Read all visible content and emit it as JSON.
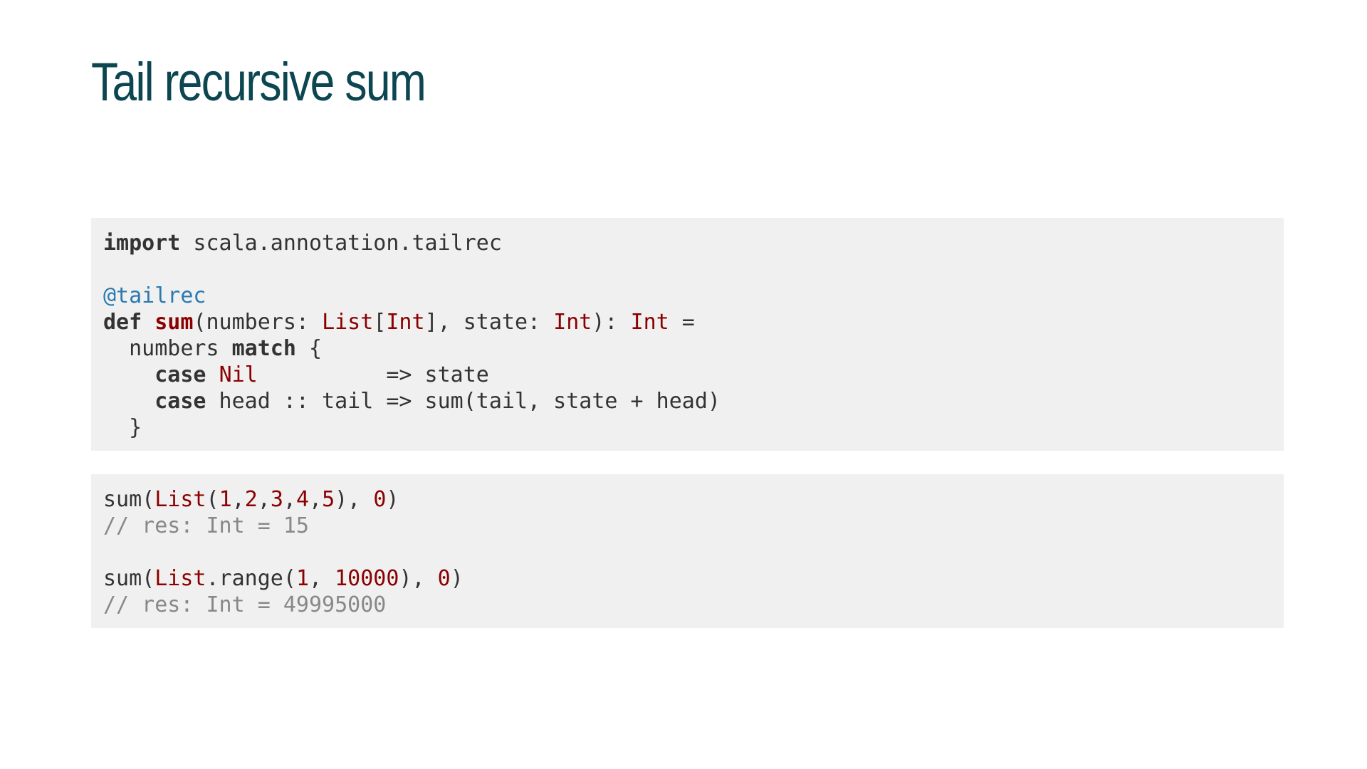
{
  "title": "Tail recursive sum",
  "colors": {
    "title": "#0c4650",
    "code_background": "#f0f0f0",
    "code_text": "#333333",
    "type_red": "#8b0000",
    "annotation_blue": "#2a7ab0",
    "comment_gray": "#888888"
  },
  "code_blocks": [
    {
      "lines": [
        [
          {
            "t": "import",
            "k": "kw"
          },
          {
            "t": " scala.annotation.tailrec",
            "k": "plain"
          }
        ],
        [],
        [
          {
            "t": "@tailrec",
            "k": "anno"
          }
        ],
        [
          {
            "t": "def",
            "k": "kw"
          },
          {
            "t": " ",
            "k": "plain"
          },
          {
            "t": "sum",
            "k": "fn"
          },
          {
            "t": "(numbers: ",
            "k": "plain"
          },
          {
            "t": "List",
            "k": "type"
          },
          {
            "t": "[",
            "k": "plain"
          },
          {
            "t": "Int",
            "k": "type"
          },
          {
            "t": "], state: ",
            "k": "plain"
          },
          {
            "t": "Int",
            "k": "type"
          },
          {
            "t": "): ",
            "k": "plain"
          },
          {
            "t": "Int",
            "k": "type"
          },
          {
            "t": " =",
            "k": "plain"
          }
        ],
        [
          {
            "t": "  numbers ",
            "k": "plain"
          },
          {
            "t": "match",
            "k": "kw"
          },
          {
            "t": " {",
            "k": "plain"
          }
        ],
        [
          {
            "t": "    ",
            "k": "plain"
          },
          {
            "t": "case",
            "k": "kw"
          },
          {
            "t": " ",
            "k": "plain"
          },
          {
            "t": "Nil",
            "k": "type"
          },
          {
            "t": "          => state",
            "k": "plain"
          }
        ],
        [
          {
            "t": "    ",
            "k": "plain"
          },
          {
            "t": "case",
            "k": "kw"
          },
          {
            "t": " head :: tail => sum(tail, state + head)",
            "k": "plain"
          }
        ],
        [
          {
            "t": "  }",
            "k": "plain"
          }
        ]
      ]
    },
    {
      "lines": [
        [
          {
            "t": "sum(",
            "k": "plain"
          },
          {
            "t": "List",
            "k": "type"
          },
          {
            "t": "(",
            "k": "plain"
          },
          {
            "t": "1",
            "k": "num"
          },
          {
            "t": ",",
            "k": "plain"
          },
          {
            "t": "2",
            "k": "num"
          },
          {
            "t": ",",
            "k": "plain"
          },
          {
            "t": "3",
            "k": "num"
          },
          {
            "t": ",",
            "k": "plain"
          },
          {
            "t": "4",
            "k": "num"
          },
          {
            "t": ",",
            "k": "plain"
          },
          {
            "t": "5",
            "k": "num"
          },
          {
            "t": "), ",
            "k": "plain"
          },
          {
            "t": "0",
            "k": "num"
          },
          {
            "t": ")",
            "k": "plain"
          }
        ],
        [
          {
            "t": "// res: Int = 15",
            "k": "comment"
          }
        ],
        [],
        [
          {
            "t": "sum(",
            "k": "plain"
          },
          {
            "t": "List",
            "k": "type"
          },
          {
            "t": ".range(",
            "k": "plain"
          },
          {
            "t": "1",
            "k": "num"
          },
          {
            "t": ", ",
            "k": "plain"
          },
          {
            "t": "10000",
            "k": "num"
          },
          {
            "t": "), ",
            "k": "plain"
          },
          {
            "t": "0",
            "k": "num"
          },
          {
            "t": ")",
            "k": "plain"
          }
        ],
        [
          {
            "t": "// res: Int = 49995000",
            "k": "comment"
          }
        ]
      ]
    }
  ]
}
